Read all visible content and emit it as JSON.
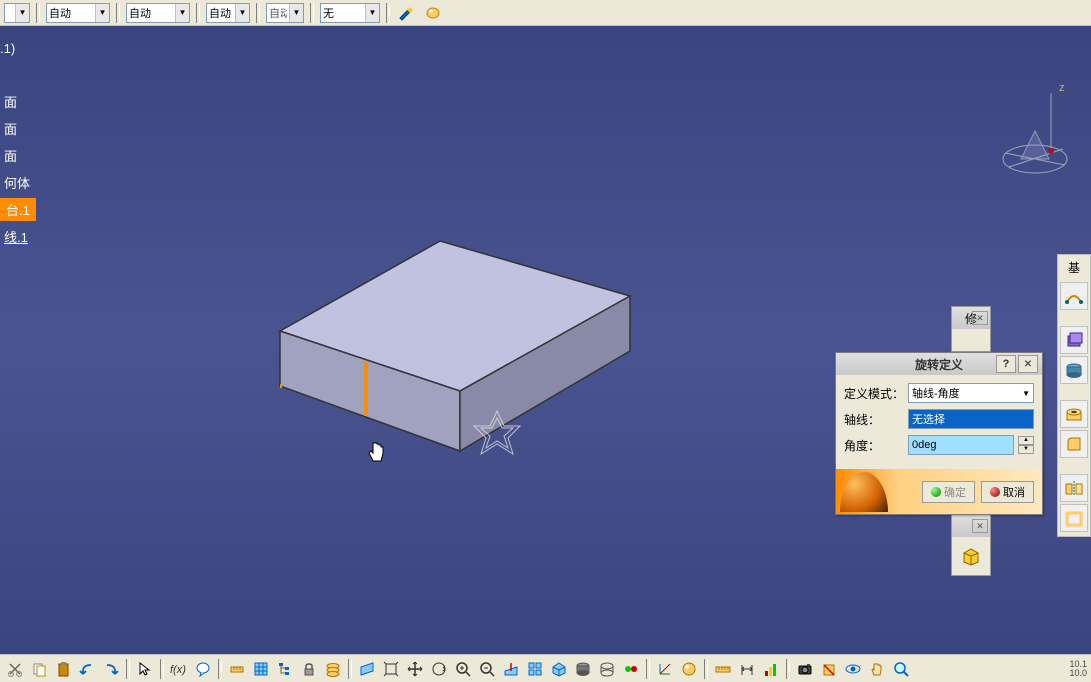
{
  "top": {
    "combos": [
      "",
      "自动",
      "自动",
      "自动",
      "自动",
      "无"
    ]
  },
  "tree": {
    "version": ".1)",
    "items": [
      "面",
      "面",
      "面",
      "何体"
    ],
    "highlight": "台.1",
    "underline": "线.1"
  },
  "compass": {
    "z_label": "z"
  },
  "dialog": {
    "title": "旋转定义",
    "mode_label": "定义模式：",
    "mode_value": "轴线-角度",
    "axis_label": "轴线：",
    "axis_value": "无选择",
    "angle_label": "角度：",
    "angle_value": "0deg",
    "ok": "确定",
    "cancel": "取消"
  },
  "panel1": {
    "title": "修"
  },
  "panel2": {
    "title": ""
  },
  "right": {
    "title": "基"
  },
  "status": {
    "line1": "10.1",
    "line2": "10.0"
  }
}
